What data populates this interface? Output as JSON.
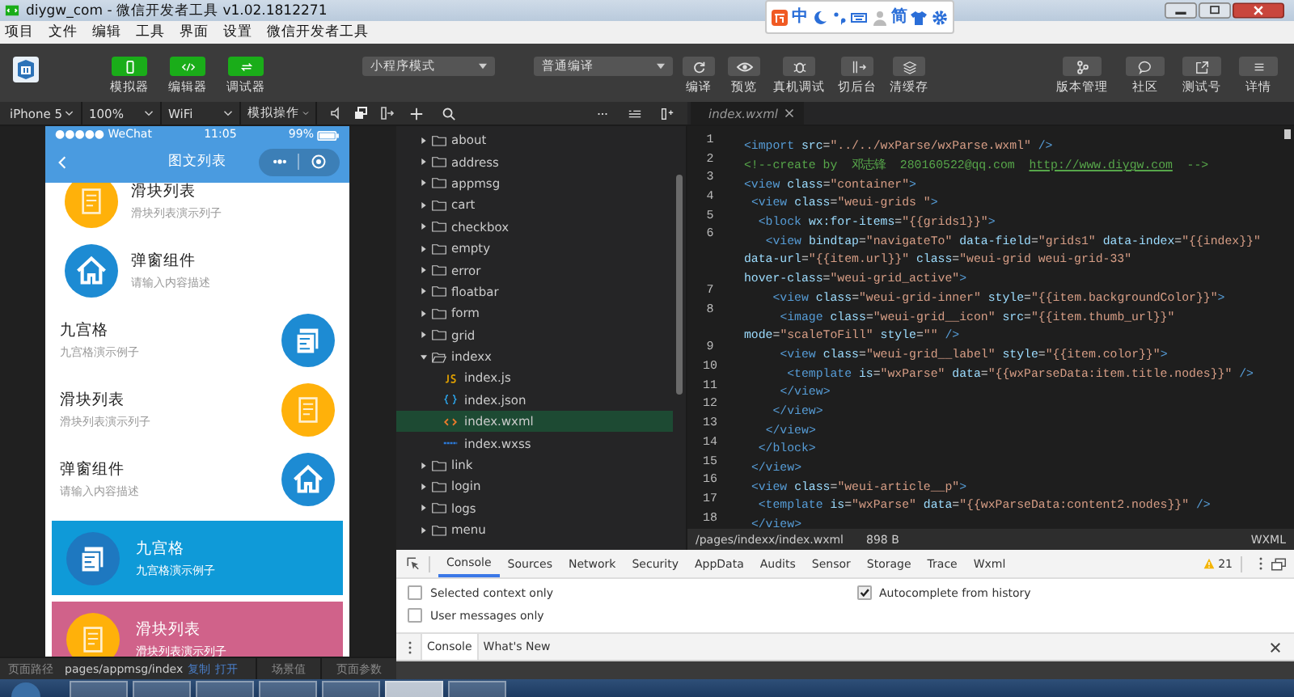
{
  "window": {
    "title": "diygw_com - 微信开发者工具 v1.02.1812271"
  },
  "ime_toolbar": {
    "items": [
      {
        "kind": "logo"
      },
      {
        "kind": "text",
        "text": "中"
      },
      {
        "kind": "moon"
      },
      {
        "kind": "punct"
      },
      {
        "kind": "keyboard"
      },
      {
        "kind": "person"
      },
      {
        "kind": "text",
        "text": "简"
      },
      {
        "kind": "shirt"
      },
      {
        "kind": "gear"
      }
    ]
  },
  "menu": [
    "项目",
    "文件",
    "编辑",
    "工具",
    "界面",
    "设置",
    "微信开发者工具"
  ],
  "toolbar": {
    "modes": [
      {
        "label": "模拟器",
        "on": true
      },
      {
        "label": "编辑器",
        "on": true
      },
      {
        "label": "调试器",
        "on": true
      }
    ],
    "dropdowns": [
      "小程序模式",
      "普通编译"
    ],
    "actions": [
      "编译",
      "预览",
      "真机调试",
      "切后台",
      "清缓存"
    ],
    "right_actions": [
      "版本管理",
      "社区",
      "测试号",
      "详情"
    ]
  },
  "simulator_toolbar": {
    "dropdowns": [
      "iPhone 5",
      "100%",
      "WiFi",
      "模拟操作"
    ]
  },
  "phone": {
    "carrier": "●●●●● WeChat",
    "time": "11:05",
    "battery": "99%",
    "title": "图文列表",
    "items": [
      {
        "kind": "left",
        "title": "滑块列表",
        "desc": "滑块列表演示列子",
        "color": "#ffb10a"
      },
      {
        "kind": "left",
        "title": "弹窗组件",
        "desc": "请输入内容描述",
        "color": "#1d8bd3"
      },
      {
        "kind": "right",
        "title": "九宫格",
        "desc": "九宫格演示例子",
        "color": "#1d8bd3"
      },
      {
        "kind": "right",
        "title": "滑块列表",
        "desc": "滑块列表演示列子",
        "color": "#ffb10a"
      },
      {
        "kind": "right",
        "title": "弹窗组件",
        "desc": "请输入内容描述",
        "color": "#1d8bd3"
      },
      {
        "kind": "card",
        "title": "九宫格",
        "desc": "九宫格演示例子",
        "color": "#0f9ad8"
      },
      {
        "kind": "card",
        "title": "滑块列表",
        "desc": "滑块列表演示列子",
        "color": "#d0628a"
      }
    ]
  },
  "simulator_footer": {
    "path_label": "页面路径",
    "path": "pages/appmsg/index",
    "copy": "复制",
    "open": "打开",
    "scene": "场景值",
    "params": "页面参数"
  },
  "file_tree": {
    "items": [
      {
        "name": "about",
        "kind": "folder",
        "expanded": false,
        "selected": false
      },
      {
        "name": "address",
        "kind": "folder",
        "expanded": false,
        "selected": false
      },
      {
        "name": "appmsg",
        "kind": "folder",
        "expanded": false,
        "selected": false
      },
      {
        "name": "cart",
        "kind": "folder",
        "expanded": false,
        "selected": false
      },
      {
        "name": "checkbox",
        "kind": "folder",
        "expanded": false,
        "selected": false
      },
      {
        "name": "empty",
        "kind": "folder",
        "expanded": false,
        "selected": false
      },
      {
        "name": "error",
        "kind": "folder",
        "expanded": false,
        "selected": false
      },
      {
        "name": "floatbar",
        "kind": "folder",
        "expanded": false,
        "selected": false
      },
      {
        "name": "form",
        "kind": "folder",
        "expanded": false,
        "selected": false
      },
      {
        "name": "grid",
        "kind": "folder",
        "expanded": false,
        "selected": false
      },
      {
        "name": "indexx",
        "kind": "folder",
        "expanded": true,
        "selected": false,
        "children": [
          {
            "name": "index.js",
            "kind": "js",
            "selected": false
          },
          {
            "name": "index.json",
            "kind": "json",
            "selected": false
          },
          {
            "name": "index.wxml",
            "kind": "wxml",
            "selected": true
          },
          {
            "name": "index.wxss",
            "kind": "wxss",
            "selected": false
          }
        ]
      },
      {
        "name": "link",
        "kind": "folder",
        "expanded": false,
        "selected": false
      },
      {
        "name": "login",
        "kind": "folder",
        "expanded": false,
        "selected": false
      },
      {
        "name": "logs",
        "kind": "folder",
        "expanded": false,
        "selected": false
      },
      {
        "name": "menu",
        "kind": "folder",
        "expanded": false,
        "selected": false
      }
    ]
  },
  "editor": {
    "tab": "index.wxml",
    "lines": [
      {
        "number": "1",
        "kind": "code",
        "rows": [
          "<import src=\"../../wxParse/wxParse.wxml\" />"
        ]
      },
      {
        "number": "2",
        "kind": "comment",
        "rows": [
          "<!--create by  邓志锋  280160522@qq.com  "
        ],
        "link": "http://www.diygw.com",
        "tail": "  -->"
      },
      {
        "number": "3",
        "kind": "code",
        "rows": [
          "<view class=\"container\">"
        ]
      },
      {
        "number": "4",
        "kind": "code",
        "rows": [
          " <view class=\"weui-grids \">"
        ]
      },
      {
        "number": "5",
        "kind": "code",
        "rows": [
          "  <block wx:for-items=\"{{grids1}}\">"
        ]
      },
      {
        "number": "6",
        "kind": "code",
        "rows": [
          "   <view bindtap=\"navigateTo\" data-field=\"grids1\" data-index=\"{{index}}\"",
          "data-url=\"{{item.url}}\" class=\"weui-grid weui-grid-33\"",
          "hover-class=\"weui-grid_active\">"
        ]
      },
      {
        "number": "7",
        "kind": "code",
        "rows": [
          "    <view class=\"weui-grid-inner\" style=\"{{item.backgroundColor}}\">"
        ]
      },
      {
        "number": "8",
        "kind": "code",
        "rows": [
          "     <image class=\"weui-grid__icon\" src=\"{{item.thumb_url}}\"",
          "mode=\"scaleToFill\" style=\"\" />"
        ]
      },
      {
        "number": "9",
        "kind": "code",
        "rows": [
          "     <view class=\"weui-grid__label\" style=\"{{item.color}}\">"
        ]
      },
      {
        "number": "10",
        "kind": "code",
        "rows": [
          "      <template is=\"wxParse\" data=\"{{wxParseData:item.title.nodes}}\" />"
        ]
      },
      {
        "number": "11",
        "kind": "code",
        "rows": [
          "     </view>"
        ]
      },
      {
        "number": "12",
        "kind": "code",
        "rows": [
          "    </view>"
        ]
      },
      {
        "number": "13",
        "kind": "code",
        "rows": [
          "   </view>"
        ]
      },
      {
        "number": "14",
        "kind": "code",
        "rows": [
          "  </block>"
        ]
      },
      {
        "number": "15",
        "kind": "code",
        "rows": [
          " </view>"
        ]
      },
      {
        "number": "16",
        "kind": "code",
        "rows": [
          " <view class=\"weui-article__p\">"
        ]
      },
      {
        "number": "17",
        "kind": "code",
        "rows": [
          "  <template is=\"wxParse\" data=\"{{wxParseData:content2.nodes}}\" />"
        ]
      },
      {
        "number": "18",
        "kind": "code",
        "rows": [
          " </view>"
        ]
      }
    ],
    "status": {
      "path": "/pages/indexx/index.wxml",
      "size": "898 B",
      "language": "WXML"
    }
  },
  "devtools": {
    "tabs": [
      {
        "label": "Console",
        "selected": true
      },
      {
        "label": "Sources",
        "selected": false
      },
      {
        "label": "Network",
        "selected": false
      },
      {
        "label": "Security",
        "selected": false
      },
      {
        "label": "AppData",
        "selected": false
      },
      {
        "label": "Audits",
        "selected": false
      },
      {
        "label": "Sensor",
        "selected": false
      },
      {
        "label": "Storage",
        "selected": false
      },
      {
        "label": "Trace",
        "selected": false
      },
      {
        "label": "Wxml",
        "selected": false
      }
    ],
    "warnings": "21",
    "options_left": [
      {
        "label": "Selected context only",
        "checked": false
      },
      {
        "label": "User messages only",
        "checked": false
      }
    ],
    "options_right": [
      {
        "label": "Autocomplete from history",
        "checked": true
      }
    ],
    "drawer_tabs": [
      {
        "label": "Console",
        "selected": true
      },
      {
        "label": "What's New",
        "selected": false
      }
    ]
  }
}
